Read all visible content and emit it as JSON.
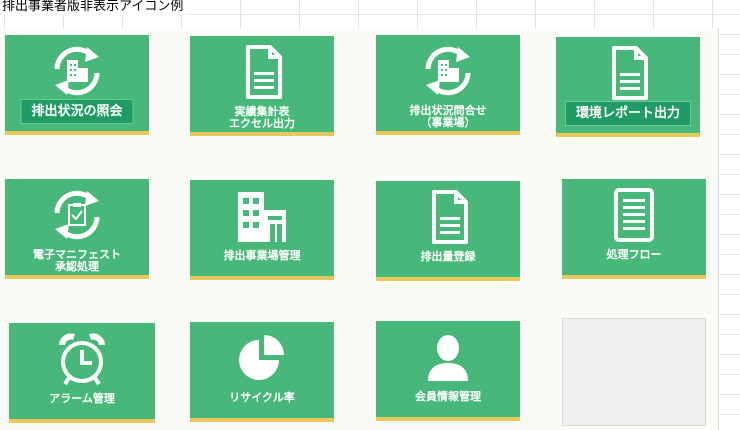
{
  "sheet": {
    "title": "排出事業者版非表示アイコン例"
  },
  "tiles": [
    {
      "label": "排出状況の照会",
      "icon": "refresh-building-icon"
    },
    {
      "label": "実績集計表\nエクセル出力",
      "icon": "document-icon"
    },
    {
      "label": "排出状況問合せ\n（事業場）",
      "icon": "refresh-building-icon"
    },
    {
      "label": "環境レポート出力",
      "icon": "document-icon"
    },
    {
      "label": "電子マニフェスト\n承認処理",
      "icon": "refresh-clipboard-icon"
    },
    {
      "label": "排出事業場管理",
      "icon": "building-icon"
    },
    {
      "label": "排出量登録",
      "icon": "document-icon"
    },
    {
      "label": "処理フロー",
      "icon": "list-document-icon"
    },
    {
      "label": "アラーム管理",
      "icon": "alarm-clock-icon"
    },
    {
      "label": "リサイクル率",
      "icon": "pie-chart-icon"
    },
    {
      "label": "会員情報管理",
      "icon": "person-icon"
    }
  ],
  "colors": {
    "tile": "#47b87a",
    "tile_accent": "#e8c85a",
    "label_box": "#1f9b63"
  }
}
